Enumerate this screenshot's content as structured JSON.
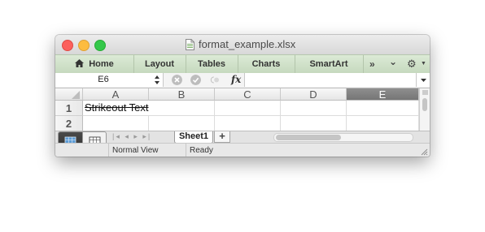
{
  "window": {
    "title": "format_example.xlsx"
  },
  "ribbon": {
    "tabs": [
      {
        "label": "Home"
      },
      {
        "label": "Layout"
      },
      {
        "label": "Tables"
      },
      {
        "label": "Charts"
      },
      {
        "label": "SmartArt"
      }
    ],
    "overflow_glyph": "»",
    "collapse_glyph": "⌄",
    "settings_glyph": "⚙"
  },
  "formula_bar": {
    "name_box": "E6",
    "fx_label": "fx",
    "value": ""
  },
  "grid": {
    "columns": [
      "A",
      "B",
      "C",
      "D",
      "E"
    ],
    "selected_column": "E",
    "rows": [
      "1",
      "2"
    ],
    "cells": {
      "A1": "Strikeout Text"
    }
  },
  "sheets": {
    "tabs": [
      "Sheet1"
    ],
    "add_label": "+",
    "nav_glyphs": "|◂ ◂ ▸ ▸|"
  },
  "status": {
    "view": "Normal View",
    "state": "Ready"
  },
  "colors": {
    "ribbon": "#cfe0c8",
    "selected_header": "#7e7e7e",
    "close": "#fc605c",
    "minimize": "#fdbc40",
    "maximize": "#34c84a"
  },
  "icons": [
    "document-icon",
    "home-icon",
    "clear-icon",
    "confirm-icon",
    "undo-icon",
    "grid-view-icon",
    "page-view-icon",
    "resize-grip-icon"
  ]
}
